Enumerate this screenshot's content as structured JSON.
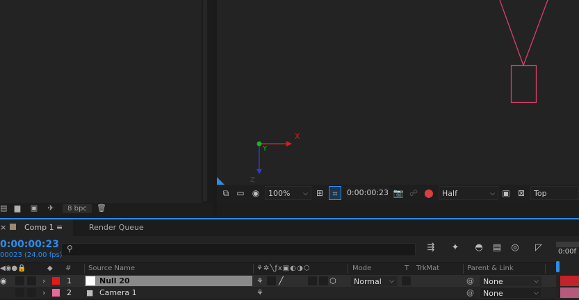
{
  "project_panel": {
    "bpc_label": "8 bpc"
  },
  "viewer": {
    "axis": {
      "x_label": "X",
      "y_label": "Y",
      "z_label": "Z"
    },
    "toolbar": {
      "zoom_value": "100%",
      "timecode": "0:00:00:23",
      "resolution_value": "Half",
      "view_value": "Top"
    },
    "colors": {
      "camera": "#d8406a",
      "x_axis": "#d22020",
      "y_axis": "#20b020",
      "z_axis": "#2a3cd8",
      "accent": "#2d8ceb"
    }
  },
  "timeline": {
    "tabs": [
      {
        "label": "Comp 1",
        "close": "×",
        "menu": "≡"
      },
      {
        "label": "Render Queue"
      }
    ],
    "timecode": "0:00:00:23",
    "frame_info": "00023 (24.00 fps)",
    "ruler_label": "0:00f",
    "columns": {
      "number": "#",
      "source_name": "Source Name",
      "mode": "Mode",
      "t": "T",
      "trkmat": "TrkMat",
      "parent_link": "Parent & Link"
    },
    "layers": [
      {
        "number": "1",
        "name": "Null 20",
        "label_color": "#e01b1b",
        "mode": "Normal",
        "parent": "None"
      },
      {
        "number": "2",
        "name": "Camera 1",
        "label_color": "#e86a9a",
        "mode": "",
        "parent": "None"
      }
    ]
  }
}
